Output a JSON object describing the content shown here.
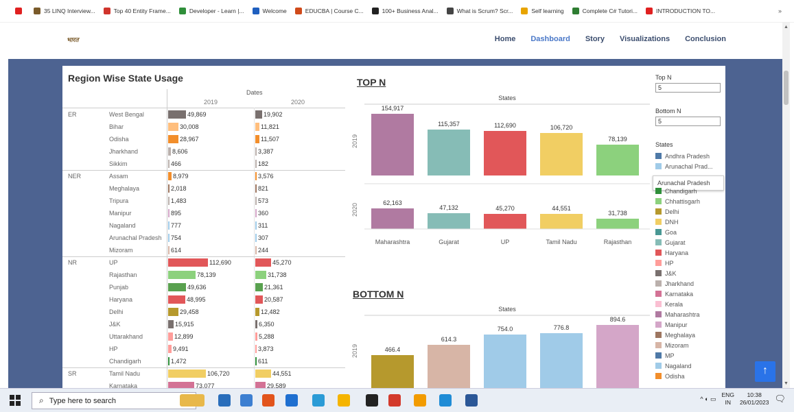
{
  "bookmarks": [
    {
      "label": "",
      "color": "#e02020"
    },
    {
      "label": "35 LINQ Interview...",
      "color": "#7a5a2a"
    },
    {
      "label": "Top 40 Entity Frame...",
      "color": "#d0342c"
    },
    {
      "label": "Developer - Learn |...",
      "color": "#2f8f3a"
    },
    {
      "label": "Welcome",
      "color": "#1f5fbf"
    },
    {
      "label": "EDUCBA | Course C...",
      "color": "#d04a1a"
    },
    {
      "label": "100+ Business Anal...",
      "color": "#222"
    },
    {
      "label": "What is Scrum? Scr...",
      "color": "#444"
    },
    {
      "label": "Self learning",
      "color": "#e8a400"
    },
    {
      "label": "Complete C# Tutori...",
      "color": "#2e7d32"
    },
    {
      "label": "INTRODUCTION TO...",
      "color": "#e02020"
    }
  ],
  "bookmark_more": "»",
  "nav": {
    "logo": "भारत",
    "links": [
      "Home",
      "Dashboard",
      "Story",
      "Visualizations",
      "Conclusion"
    ],
    "active": "Dashboard"
  },
  "table": {
    "title": "Region Wise State Usage",
    "dates_header": "Dates",
    "years": [
      "2019",
      "2020"
    ],
    "regions": [
      {
        "name": "ER",
        "rows": [
          [
            "West Bengal",
            49869,
            "49,869",
            19902,
            "19,902"
          ],
          [
            "Bihar",
            30008,
            "30,008",
            11821,
            "11,821"
          ],
          [
            "Odisha",
            28967,
            "28,967",
            11507,
            "11,507"
          ],
          [
            "Jharkhand",
            8606,
            "8,606",
            3387,
            "3,387"
          ],
          [
            "Sikkim",
            466,
            "466",
            182,
            "182"
          ]
        ]
      },
      {
        "name": "NER",
        "rows": [
          [
            "Assam",
            8979,
            "8,979",
            3576,
            "3,576"
          ],
          [
            "Meghalaya",
            2018,
            "2,018",
            821,
            "821"
          ],
          [
            "Tripura",
            1483,
            "1,483",
            573,
            "573"
          ],
          [
            "Manipur",
            895,
            "895",
            360,
            "360"
          ],
          [
            "Nagaland",
            777,
            "777",
            311,
            "311"
          ],
          [
            "Arunachal Pradesh",
            754,
            "754",
            307,
            "307"
          ],
          [
            "Mizoram",
            614,
            "614",
            244,
            "244"
          ]
        ]
      },
      {
        "name": "NR",
        "rows": [
          [
            "UP",
            112690,
            "112,690",
            45270,
            "45,270"
          ],
          [
            "Rajasthan",
            78139,
            "78,139",
            31738,
            "31,738"
          ],
          [
            "Punjab",
            49636,
            "49,636",
            21361,
            "21,361"
          ],
          [
            "Haryana",
            48995,
            "48,995",
            20587,
            "20,587"
          ],
          [
            "Delhi",
            29458,
            "29,458",
            12482,
            "12,482"
          ],
          [
            "J&K",
            15915,
            "15,915",
            6350,
            "6,350"
          ],
          [
            "Uttarakhand",
            12899,
            "12,899",
            5288,
            "5,288"
          ],
          [
            "HP",
            9491,
            "9,491",
            3873,
            "3,873"
          ],
          [
            "Chandigarh",
            1472,
            "1,472",
            611,
            "611"
          ]
        ]
      },
      {
        "name": "SR",
        "rows": [
          [
            "Tamil Nadu",
            106720,
            "106,720",
            44551,
            "44,551"
          ],
          [
            "Karnataka",
            73077,
            "73,077",
            29589,
            "29,589"
          ]
        ]
      }
    ]
  },
  "topn": {
    "title": "TOP N",
    "states_label": "States",
    "categories": [
      "Maharashtra",
      "Gujarat",
      "UP",
      "Tamil Nadu",
      "Rajasthan"
    ],
    "rows": [
      {
        "year": "2019",
        "values": [
          154917,
          115357,
          112690,
          106720,
          78139
        ],
        "labels": [
          "154,917",
          "115,357",
          "112,690",
          "106,720",
          "78,139"
        ]
      },
      {
        "year": "2020",
        "values": [
          62163,
          47132,
          45270,
          44551,
          31738
        ],
        "labels": [
          "62,163",
          "47,132",
          "45,270",
          "44,551",
          "31,738"
        ]
      }
    ]
  },
  "bottomn": {
    "title": "BOTTOM N",
    "states_label": "States",
    "year": "2019",
    "values": [
      466.4,
      614.3,
      754.0,
      776.8,
      894.6
    ],
    "labels": [
      "466.4",
      "614.3",
      "754.0",
      "776.8",
      "894.6"
    ]
  },
  "controls": {
    "topn_label": "Top N",
    "topn_value": "5",
    "bottomn_label": "Bottom N",
    "bottomn_value": "5",
    "states_label": "States"
  },
  "legend": [
    {
      "name": "Andhra Pradesh",
      "color": "#4e79a7"
    },
    {
      "name": "Arunachal Prad...",
      "color": "#a0cbe8"
    },
    {
      "name": "Chandigarh",
      "color": "#2f8f3a"
    },
    {
      "name": "Chhattisgarh",
      "color": "#8cd17d"
    },
    {
      "name": "Delhi",
      "color": "#b6992d"
    },
    {
      "name": "DNH",
      "color": "#f1ce63"
    },
    {
      "name": "Goa",
      "color": "#499894"
    },
    {
      "name": "Gujarat",
      "color": "#86bcb6"
    },
    {
      "name": "Haryana",
      "color": "#e15759"
    },
    {
      "name": "HP",
      "color": "#ff9d9a"
    },
    {
      "name": "J&K",
      "color": "#79706e"
    },
    {
      "name": "Jharkhand",
      "color": "#bab0ac"
    },
    {
      "name": "Karnataka",
      "color": "#d37295"
    },
    {
      "name": "Kerala",
      "color": "#fabfd2"
    },
    {
      "name": "Maharashtra",
      "color": "#b07aa1"
    },
    {
      "name": "Manipur",
      "color": "#d4a6c8"
    },
    {
      "name": "Meghalaya",
      "color": "#9d7660"
    },
    {
      "name": "Mizoram",
      "color": "#d7b5a6"
    },
    {
      "name": "MP",
      "color": "#4e79a7"
    },
    {
      "name": "Nagaland",
      "color": "#a0cbe8"
    },
    {
      "name": "Odisha",
      "color": "#f28e2b"
    }
  ],
  "tooltip": "Arunachal Pradesh",
  "taskbar": {
    "search_placeholder": "Type here to search",
    "lang1": "ENG",
    "lang2": "IN",
    "time": "10:38",
    "date": "26/01/2023"
  }
}
